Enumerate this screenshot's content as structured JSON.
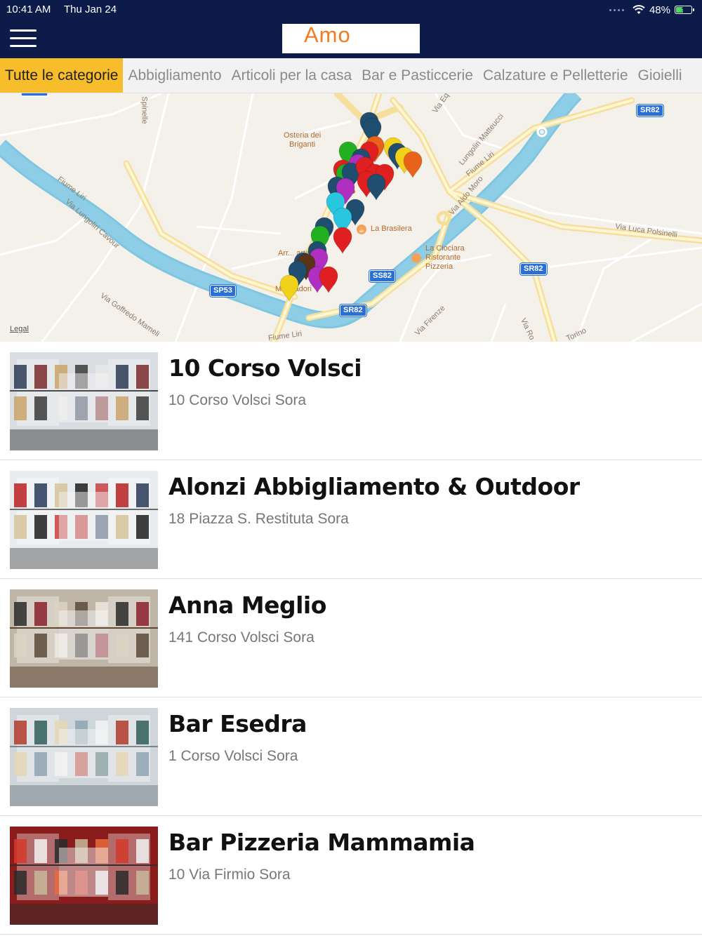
{
  "status": {
    "time": "10:41 AM",
    "date": "Thu Jan 24",
    "battery": "48%",
    "battery_level": 0.48
  },
  "header": {
    "logo_text": "Amo"
  },
  "categories": [
    {
      "label": "Tutte le categorie",
      "active": true
    },
    {
      "label": "Abbigliamento",
      "active": false
    },
    {
      "label": "Articoli per la casa",
      "active": false
    },
    {
      "label": "Bar e Pasticcerie",
      "active": false
    },
    {
      "label": "Calzature e Pelletterie",
      "active": false
    },
    {
      "label": "Gioielli",
      "active": false
    }
  ],
  "map": {
    "labels": {
      "osteria": "Osteria dei\nBriganti",
      "brasilera": "La Brasilera",
      "ciociara": "La Ciociara\nRistorante\nPizzeria",
      "mondadori": "Mondadori",
      "martini": "Arr... artini",
      "fiume_liri_1": "Fiume Liri",
      "fiume_liri_2": "Fiume Liri",
      "fiume_liri_3": "Fiume Liri",
      "lungoliri_cavour": "Via Lungoliri Cavour",
      "lungoliri_matteucci": "Lungoliri Matteucci",
      "aldo_moro": "Via Aldo Moro",
      "luca_polsinelli": "Via Luca Polsinelli",
      "goffredo_mameli": "Via Goffredo Mameli",
      "firenze": "Via Firenze",
      "spinelle": "Spinelle",
      "torino": "Torino",
      "via_ro": "Via Ro",
      "via_eq": "Via Eq"
    },
    "shields": [
      "SR82",
      "SP53",
      "SS82",
      "SR82",
      "SR82"
    ],
    "legal": "Legal",
    "pin_colors": [
      "#1f4e6e",
      "#e02020",
      "#22b022",
      "#b02fc0",
      "#f2d11a",
      "#e8621a",
      "#29c6e0",
      "#5a3318"
    ]
  },
  "stores": [
    {
      "name": "10 Corso Volsci",
      "address": "10 Corso Volsci Sora"
    },
    {
      "name": "Alonzi Abbigliamento & Outdoor",
      "address": "18 Piazza S. Restituta Sora"
    },
    {
      "name": "Anna Meglio",
      "address": "141 Corso Volsci Sora"
    },
    {
      "name": "Bar Esedra",
      "address": "1 Corso Volsci Sora"
    },
    {
      "name": "Bar Pizzeria Mammamia",
      "address": "10 Via Firmio Sora"
    }
  ]
}
